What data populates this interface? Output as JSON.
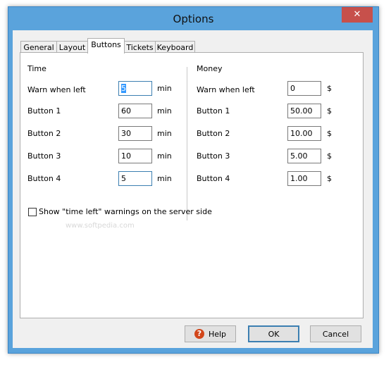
{
  "window": {
    "title": "Options",
    "close_glyph": "✕"
  },
  "tabs": [
    {
      "label": "General"
    },
    {
      "label": "Layout"
    },
    {
      "label": "Buttons"
    },
    {
      "label": "Tickets"
    },
    {
      "label": "Keyboard"
    }
  ],
  "active_tab": "Buttons",
  "time": {
    "heading": "Time",
    "unit": "min",
    "rows": [
      {
        "label": "Warn when left",
        "value": "5"
      },
      {
        "label": "Button 1",
        "value": "60"
      },
      {
        "label": "Button 2",
        "value": "30"
      },
      {
        "label": "Button 3",
        "value": "10"
      },
      {
        "label": "Button 4",
        "value": "5"
      }
    ]
  },
  "money": {
    "heading": "Money",
    "unit": "$",
    "rows": [
      {
        "label": "Warn when left",
        "value": "0"
      },
      {
        "label": "Button 1",
        "value": "50.00"
      },
      {
        "label": "Button 2",
        "value": "10.00"
      },
      {
        "label": "Button 3",
        "value": "5.00"
      },
      {
        "label": "Button 4",
        "value": "1.00"
      }
    ]
  },
  "checkbox": {
    "label": "Show \"time left\" warnings on the server side",
    "checked": false
  },
  "watermark": "www.softpedia.com",
  "buttons": {
    "help": "Help",
    "ok": "OK",
    "cancel": "Cancel"
  },
  "colors": {
    "titlebar": "#5aa3dc",
    "close": "#c7504b",
    "help_icon": "#d2461a",
    "focus": "#3c7fb1"
  }
}
